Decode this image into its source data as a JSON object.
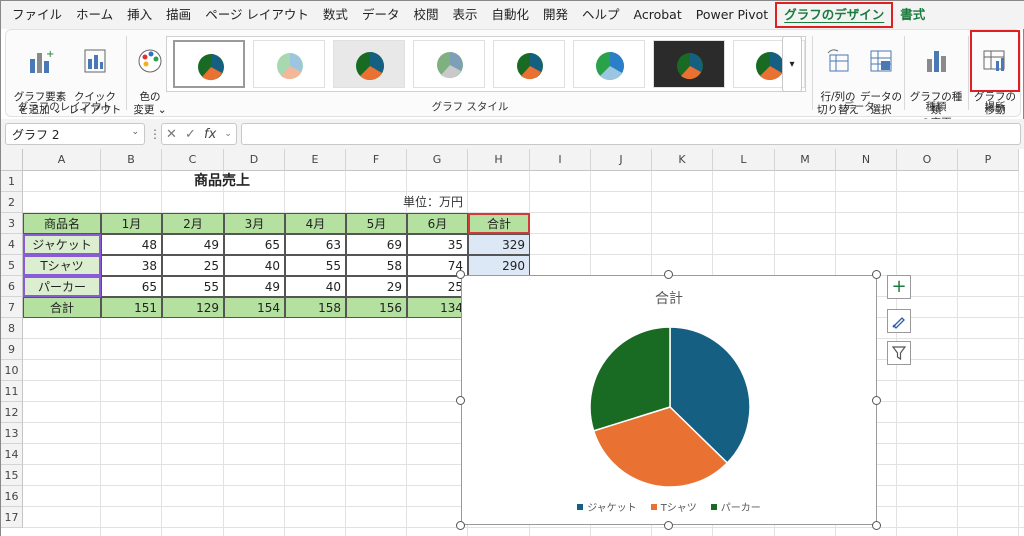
{
  "menu": [
    "ファイル",
    "ホーム",
    "挿入",
    "描画",
    "ページ レイアウト",
    "数式",
    "データ",
    "校閲",
    "表示",
    "自動化",
    "開発",
    "ヘルプ",
    "Acrobat",
    "Power Pivot",
    "グラフのデザイン",
    "書式"
  ],
  "ribbon": {
    "add_element": "グラフ要素\nを追加 ⌄",
    "quick_layout": "クイック\nレイアウト ⌄",
    "change_color": "色の\n変更 ⌄",
    "group_layout": "グラフのレイアウト",
    "group_style": "グラフ スタイル",
    "switch_row_col": "行/列の\n切り替え",
    "select_data": "データの\n選択",
    "group_data": "データ",
    "change_type": "グラフの種類\nの変更",
    "group_type": "種類",
    "move_chart": "グラフの\n移動",
    "group_location": "場所"
  },
  "formula_bar": {
    "name_box": "グラフ 2",
    "formula": ""
  },
  "columns": [
    "A",
    "B",
    "C",
    "D",
    "E",
    "F",
    "G",
    "H",
    "I",
    "J",
    "K",
    "L",
    "M",
    "N",
    "O",
    "P"
  ],
  "rows": [
    "1",
    "2",
    "3",
    "4",
    "5",
    "6",
    "7",
    "8",
    "9",
    "10",
    "11",
    "12",
    "13",
    "14",
    "15",
    "16",
    "17"
  ],
  "sheet": {
    "title": "商品売上",
    "unit": "単位：万円",
    "headers": [
      "商品名",
      "1月",
      "2月",
      "3月",
      "4月",
      "5月",
      "6月",
      "合計"
    ],
    "data": [
      [
        "ジャケット",
        "48",
        "49",
        "65",
        "63",
        "69",
        "35",
        "329"
      ],
      [
        "Tシャツ",
        "38",
        "25",
        "40",
        "55",
        "58",
        "74",
        "290"
      ],
      [
        "パーカー",
        "65",
        "55",
        "49",
        "40",
        "29",
        "25",
        ""
      ]
    ],
    "total_row": [
      "合計",
      "151",
      "129",
      "154",
      "158",
      "156",
      "134",
      ""
    ]
  },
  "chart_data": {
    "type": "pie",
    "title": "合計",
    "categories": [
      "ジャケット",
      "Tシャツ",
      "パーカー"
    ],
    "values": [
      329,
      290,
      263
    ],
    "colors": [
      "#156082",
      "#e97132",
      "#196b24"
    ],
    "legend_position": "bottom"
  }
}
